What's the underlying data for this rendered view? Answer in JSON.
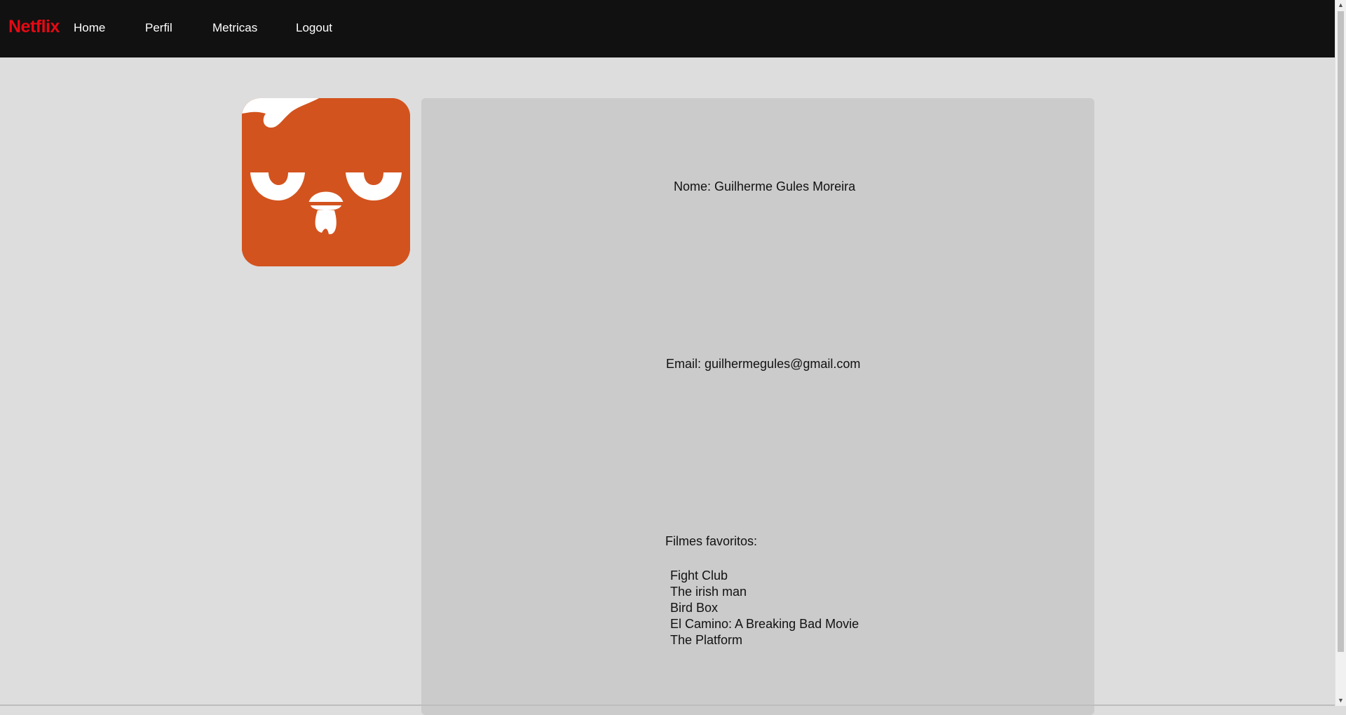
{
  "navbar": {
    "brand": "Netflix",
    "links": [
      "Home",
      "Perfil",
      "Metricas",
      "Logout"
    ]
  },
  "profile": {
    "name_line": "Nome: Guilherme Gules Moreira",
    "email_line": "Email: guilhermegules@gmail.com",
    "favorites_label": "Filmes favoritos:",
    "favorites": [
      "Fight Club",
      "The irish man",
      "Bird Box",
      "El Camino: A Breaking Bad Movie",
      "The Platform"
    ]
  },
  "avatar": {
    "icon": "grumpy-face-avatar",
    "bg_color": "#d3531e"
  },
  "colors": {
    "brand": "#e50914",
    "navbar": "#111111",
    "page_bg": "#dddddd",
    "panel_bg": "#cbcbcb"
  }
}
